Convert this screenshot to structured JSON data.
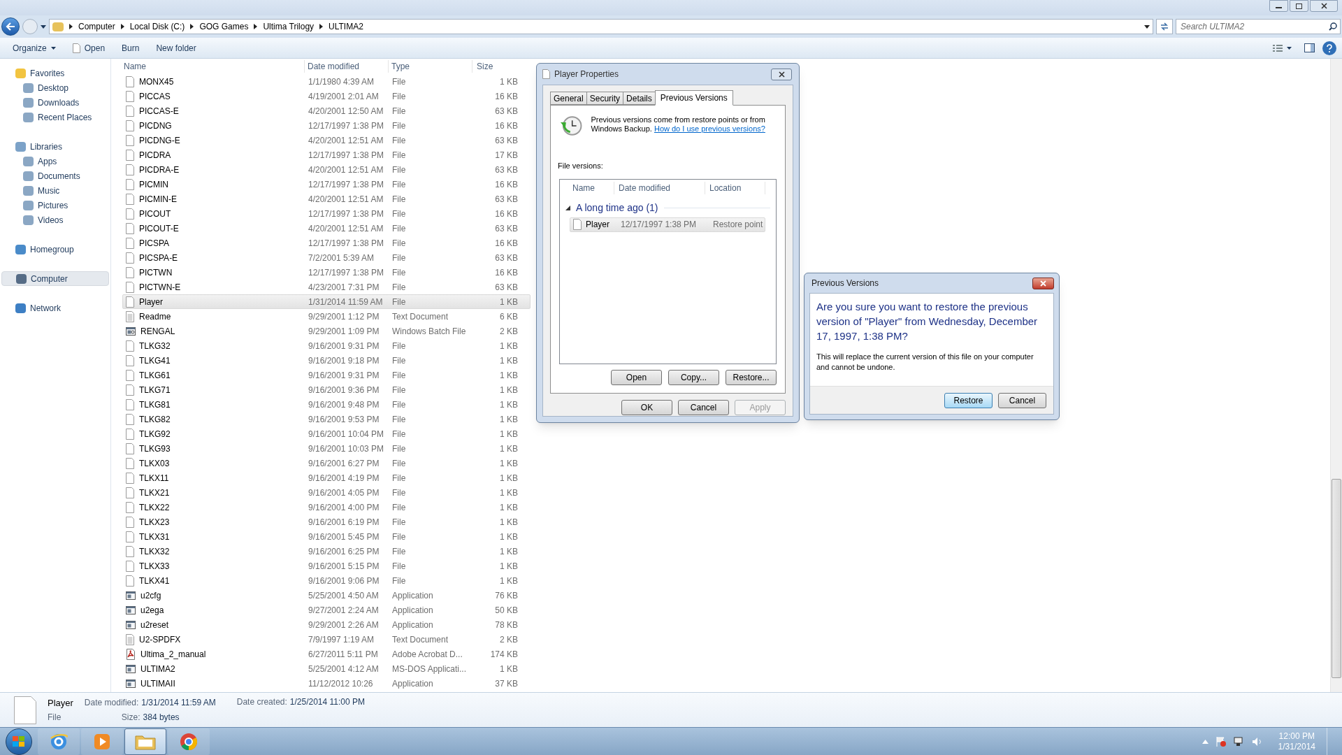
{
  "address_bar": {
    "crumbs": [
      "Computer",
      "Local Disk (C:)",
      "GOG Games",
      "Ultima Trilogy",
      "ULTIMA2"
    ],
    "search": {
      "placeholder": "Search ULTIMA2"
    }
  },
  "toolbar": {
    "items": [
      "Organize",
      "Open",
      "Burn",
      "New folder"
    ]
  },
  "sidebar": {
    "items": [
      {
        "label": "Favorites",
        "selected": false,
        "children": [
          {
            "label": "Desktop",
            "selected": false
          },
          {
            "label": "Downloads",
            "selected": false
          },
          {
            "label": "Recent Places",
            "selected": false
          }
        ]
      },
      {
        "label": "Libraries",
        "selected": false,
        "children": [
          {
            "label": "Apps",
            "selected": false
          },
          {
            "label": "Documents",
            "selected": false
          },
          {
            "label": "Music",
            "selected": false
          },
          {
            "label": "Pictures",
            "selected": false
          },
          {
            "label": "Videos",
            "selected": false
          }
        ]
      },
      {
        "label": "Homegroup",
        "selected": false
      },
      {
        "label": "Computer",
        "selected": true
      },
      {
        "label": "Network",
        "selected": false
      }
    ]
  },
  "table": {
    "columns": [
      "Name",
      "Date modified",
      "Type",
      "Size"
    ],
    "rows": [
      {
        "kind": "file",
        "name": "MONX45",
        "date": "1/1/1980 4:39 AM",
        "type": "File",
        "size": "1 KB",
        "selected": false
      },
      {
        "kind": "file",
        "name": "PICCAS",
        "date": "4/19/2001 2:01 AM",
        "type": "File",
        "size": "16 KB",
        "selected": false
      },
      {
        "kind": "file",
        "name": "PICCAS-E",
        "date": "4/20/2001 12:50 AM",
        "type": "File",
        "size": "63 KB",
        "selected": false
      },
      {
        "kind": "file",
        "name": "PICDNG",
        "date": "12/17/1997 1:38 PM",
        "type": "File",
        "size": "16 KB",
        "selected": false
      },
      {
        "kind": "file",
        "name": "PICDNG-E",
        "date": "4/20/2001 12:51 AM",
        "type": "File",
        "size": "63 KB",
        "selected": false
      },
      {
        "kind": "file",
        "name": "PICDRA",
        "date": "12/17/1997 1:38 PM",
        "type": "File",
        "size": "17 KB",
        "selected": false
      },
      {
        "kind": "file",
        "name": "PICDRA-E",
        "date": "4/20/2001 12:51 AM",
        "type": "File",
        "size": "63 KB",
        "selected": false
      },
      {
        "kind": "file",
        "name": "PICMIN",
        "date": "12/17/1997 1:38 PM",
        "type": "File",
        "size": "16 KB",
        "selected": false
      },
      {
        "kind": "file",
        "name": "PICMIN-E",
        "date": "4/20/2001 12:51 AM",
        "type": "File",
        "size": "63 KB",
        "selected": false
      },
      {
        "kind": "file",
        "name": "PICOUT",
        "date": "12/17/1997 1:38 PM",
        "type": "File",
        "size": "16 KB",
        "selected": false
      },
      {
        "kind": "file",
        "name": "PICOUT-E",
        "date": "4/20/2001 12:51 AM",
        "type": "File",
        "size": "63 KB",
        "selected": false
      },
      {
        "kind": "file",
        "name": "PICSPA",
        "date": "12/17/1997 1:38 PM",
        "type": "File",
        "size": "16 KB",
        "selected": false
      },
      {
        "kind": "file",
        "name": "PICSPA-E",
        "date": "7/2/2001 5:39 AM",
        "type": "File",
        "size": "63 KB",
        "selected": false
      },
      {
        "kind": "file",
        "name": "PICTWN",
        "date": "12/17/1997 1:38 PM",
        "type": "File",
        "size": "16 KB",
        "selected": false
      },
      {
        "kind": "file",
        "name": "PICTWN-E",
        "date": "4/23/2001 7:31 PM",
        "type": "File",
        "size": "63 KB",
        "selected": false
      },
      {
        "kind": "file",
        "name": "Player",
        "date": "1/31/2014 11:59 AM",
        "type": "File",
        "size": "1 KB",
        "selected": true
      },
      {
        "kind": "text",
        "name": "Readme",
        "date": "9/29/2001 1:12 PM",
        "type": "Text Document",
        "size": "6 KB",
        "selected": false
      },
      {
        "kind": "batch",
        "name": "RENGAL",
        "date": "9/29/2001 1:09 PM",
        "type": "Windows Batch File",
        "size": "2 KB",
        "selected": false
      },
      {
        "kind": "file",
        "name": "TLKG32",
        "date": "9/16/2001 9:31 PM",
        "type": "File",
        "size": "1 KB",
        "selected": false
      },
      {
        "kind": "file",
        "name": "TLKG41",
        "date": "9/16/2001 9:18 PM",
        "type": "File",
        "size": "1 KB",
        "selected": false
      },
      {
        "kind": "file",
        "name": "TLKG61",
        "date": "9/16/2001 9:31 PM",
        "type": "File",
        "size": "1 KB",
        "selected": false
      },
      {
        "kind": "file",
        "name": "TLKG71",
        "date": "9/16/2001 9:36 PM",
        "type": "File",
        "size": "1 KB",
        "selected": false
      },
      {
        "kind": "file",
        "name": "TLKG81",
        "date": "9/16/2001 9:48 PM",
        "type": "File",
        "size": "1 KB",
        "selected": false
      },
      {
        "kind": "file",
        "name": "TLKG82",
        "date": "9/16/2001 9:53 PM",
        "type": "File",
        "size": "1 KB",
        "selected": false
      },
      {
        "kind": "file",
        "name": "TLKG92",
        "date": "9/16/2001 10:04 PM",
        "type": "File",
        "size": "1 KB",
        "selected": false
      },
      {
        "kind": "file",
        "name": "TLKG93",
        "date": "9/16/2001 10:03 PM",
        "type": "File",
        "size": "1 KB",
        "selected": false
      },
      {
        "kind": "file",
        "name": "TLKX03",
        "date": "9/16/2001 6:27 PM",
        "type": "File",
        "size": "1 KB",
        "selected": false
      },
      {
        "kind": "file",
        "name": "TLKX11",
        "date": "9/16/2001 4:19 PM",
        "type": "File",
        "size": "1 KB",
        "selected": false
      },
      {
        "kind": "file",
        "name": "TLKX21",
        "date": "9/16/2001 4:05 PM",
        "type": "File",
        "size": "1 KB",
        "selected": false
      },
      {
        "kind": "file",
        "name": "TLKX22",
        "date": "9/16/2001 4:00 PM",
        "type": "File",
        "size": "1 KB",
        "selected": false
      },
      {
        "kind": "file",
        "name": "TLKX23",
        "date": "9/16/2001 6:19 PM",
        "type": "File",
        "size": "1 KB",
        "selected": false
      },
      {
        "kind": "file",
        "name": "TLKX31",
        "date": "9/16/2001 5:45 PM",
        "type": "File",
        "size": "1 KB",
        "selected": false
      },
      {
        "kind": "file",
        "name": "TLKX32",
        "date": "9/16/2001 6:25 PM",
        "type": "File",
        "size": "1 KB",
        "selected": false
      },
      {
        "kind": "file",
        "name": "TLKX33",
        "date": "9/16/2001 5:15 PM",
        "type": "File",
        "size": "1 KB",
        "selected": false
      },
      {
        "kind": "file",
        "name": "TLKX41",
        "date": "9/16/2001 9:06 PM",
        "type": "File",
        "size": "1 KB",
        "selected": false
      },
      {
        "kind": "app",
        "name": "u2cfg",
        "date": "5/25/2001 4:50 AM",
        "type": "Application",
        "size": "76 KB",
        "selected": false
      },
      {
        "kind": "app",
        "name": "u2ega",
        "date": "9/27/2001 2:24 AM",
        "type": "Application",
        "size": "50 KB",
        "selected": false
      },
      {
        "kind": "app",
        "name": "u2reset",
        "date": "9/29/2001 2:26 AM",
        "type": "Application",
        "size": "78 KB",
        "selected": false
      },
      {
        "kind": "text",
        "name": "U2-SPDFX",
        "date": "7/9/1997 1:19 AM",
        "type": "Text Document",
        "size": "2 KB",
        "selected": false
      },
      {
        "kind": "pdf",
        "name": "Ultima_2_manual",
        "date": "6/27/2011 5:11 PM",
        "type": "Adobe Acrobat D...",
        "size": "174 KB",
        "selected": false
      },
      {
        "kind": "app",
        "name": "ULTIMA2",
        "date": "5/25/2001 4:12 AM",
        "type": "MS-DOS Applicati...",
        "size": "1 KB",
        "selected": false
      },
      {
        "kind": "app",
        "name": "ULTIMAII",
        "date": "11/12/2012 10:26",
        "type": "Application",
        "size": "37 KB",
        "selected": false
      }
    ]
  },
  "details_pane": {
    "name": "Player",
    "type": "File",
    "fields": [
      {
        "label": "Date modified:",
        "value": "1/31/2014 11:59 AM"
      },
      {
        "label": "Size:",
        "value": "384 bytes"
      },
      {
        "label": "Date created:",
        "value": "1/25/2014 11:00 PM"
      }
    ]
  },
  "properties_dialog": {
    "title": "Player Properties",
    "tabs": [
      {
        "label": "General",
        "selected": false
      },
      {
        "label": "Security",
        "selected": false
      },
      {
        "label": "Details",
        "selected": false
      },
      {
        "label": "Previous Versions",
        "selected": true
      }
    ],
    "intro": "Previous versions come from restore points or from Windows Backup.",
    "link": "How do I use previous versions?",
    "list_label": "File versions:",
    "columns": [
      "Name",
      "Date modified",
      "Location"
    ],
    "group": {
      "label": "A long time ago (1)",
      "expanded": true,
      "rows": [
        {
          "name": "Player",
          "date": "12/17/1997 1:38 PM",
          "location": "Restore point",
          "selected": true
        }
      ]
    },
    "list_buttons": [
      "Open",
      "Copy...",
      "Restore..."
    ],
    "buttons": [
      {
        "label": "OK",
        "disabled": false
      },
      {
        "label": "Cancel",
        "disabled": false
      },
      {
        "label": "Apply",
        "disabled": true
      }
    ]
  },
  "confirm_dialog": {
    "title": "Previous Versions",
    "question": "Are you sure you want to restore the previous version of \"Player\" from Wednesday, December 17, 1997, 1:38 PM?",
    "note": "This will replace the current version of this file on your computer and cannot be undone.",
    "buttons": [
      {
        "label": "Restore",
        "default": true
      },
      {
        "label": "Cancel",
        "default": false
      }
    ]
  },
  "taskbar": {
    "apps": [
      {
        "kind": "ie",
        "active": false
      },
      {
        "kind": "media",
        "active": false
      },
      {
        "kind": "explorer",
        "active": true
      },
      {
        "kind": "chrome",
        "active": false
      }
    ],
    "clock": {
      "time": "12:00 PM",
      "date": "1/31/2014"
    }
  }
}
